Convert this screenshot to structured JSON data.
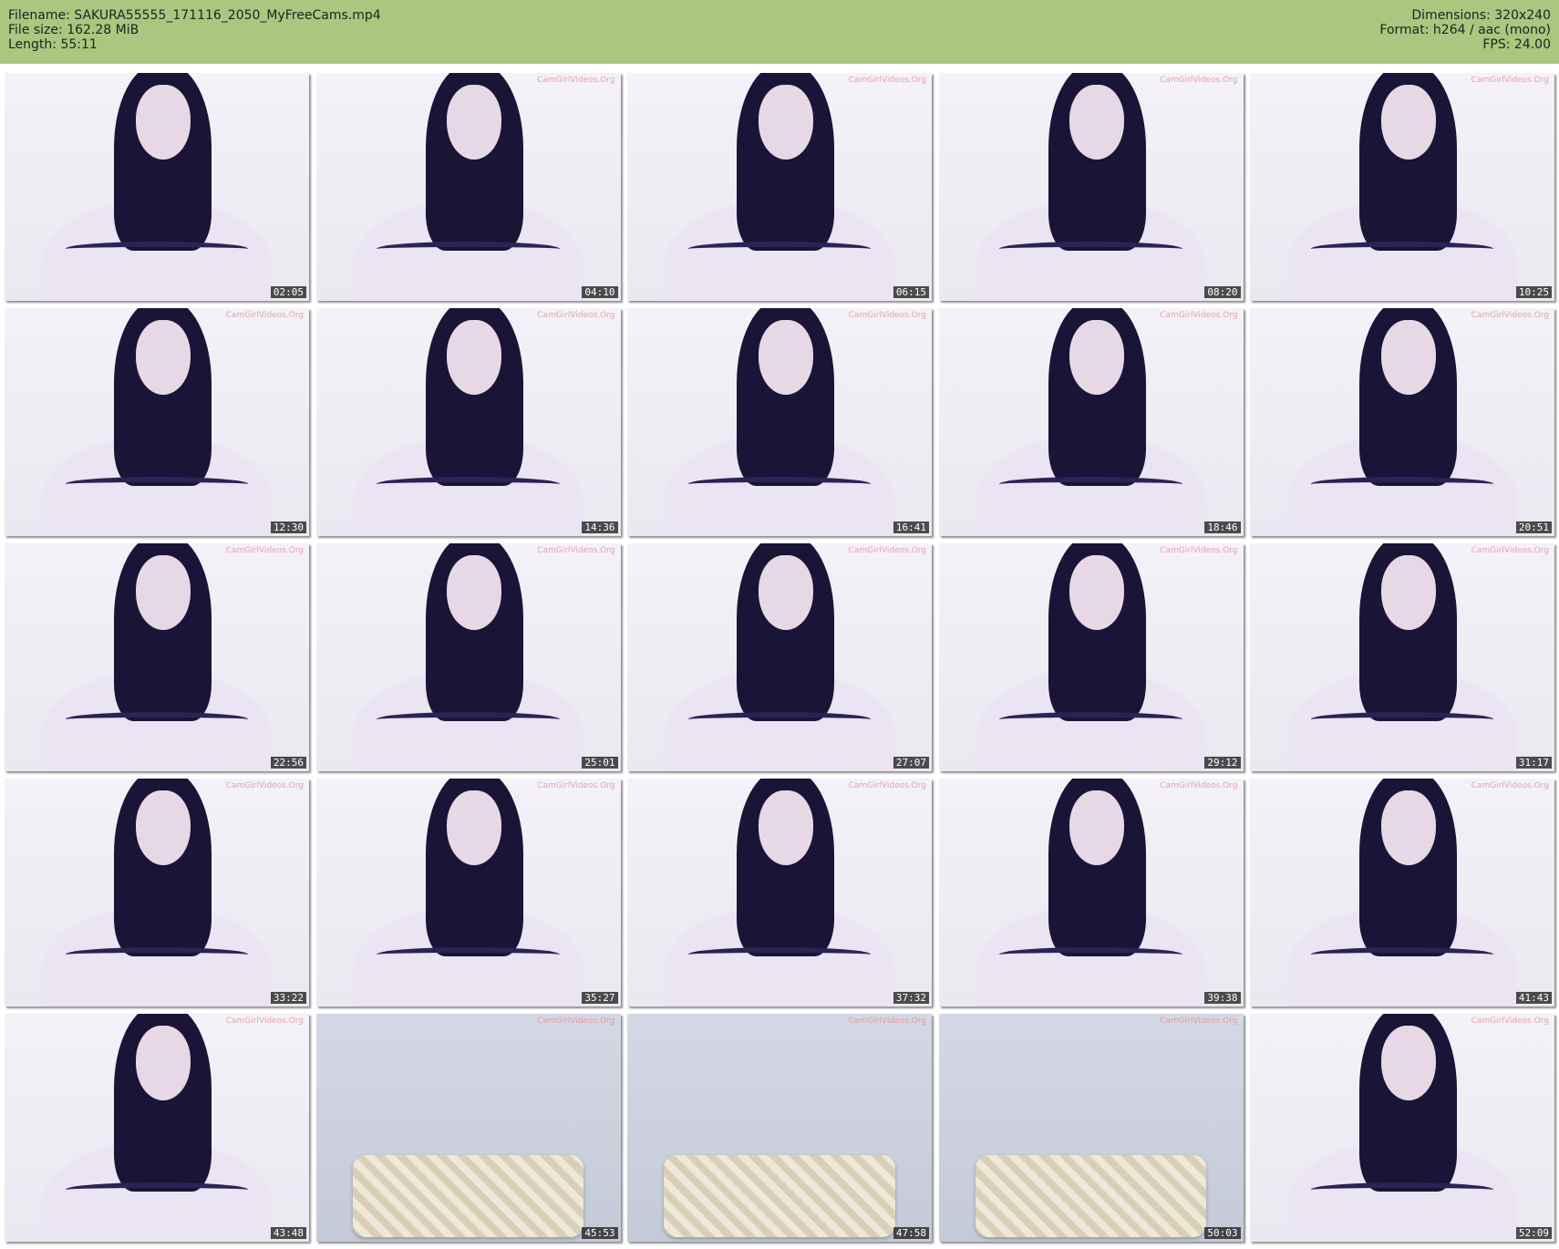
{
  "header": {
    "filename": "Filename: SAKURA55555_171116_2050_MyFreeCams.mp4",
    "file_size": "File size: 162.28 MiB",
    "length": "Length: 55:11",
    "dimensions": "Dimensions: 320x240",
    "format": "Format: h264 / aac (mono)",
    "fps": "FPS: 24.00"
  },
  "watermark_text": "CamGirlVideos.Org",
  "thumbnails": [
    {
      "time": "02:05",
      "scene": "person"
    },
    {
      "time": "04:10",
      "scene": "person"
    },
    {
      "time": "06:15",
      "scene": "person"
    },
    {
      "time": "08:20",
      "scene": "person"
    },
    {
      "time": "10:25",
      "scene": "person"
    },
    {
      "time": "12:30",
      "scene": "person"
    },
    {
      "time": "14:36",
      "scene": "person"
    },
    {
      "time": "16:41",
      "scene": "person"
    },
    {
      "time": "18:46",
      "scene": "person"
    },
    {
      "time": "20:51",
      "scene": "person"
    },
    {
      "time": "22:56",
      "scene": "person"
    },
    {
      "time": "25:01",
      "scene": "person"
    },
    {
      "time": "27:07",
      "scene": "person"
    },
    {
      "time": "29:12",
      "scene": "person"
    },
    {
      "time": "31:17",
      "scene": "person"
    },
    {
      "time": "33:22",
      "scene": "person"
    },
    {
      "time": "35:27",
      "scene": "person"
    },
    {
      "time": "37:32",
      "scene": "person"
    },
    {
      "time": "39:38",
      "scene": "person"
    },
    {
      "time": "41:43",
      "scene": "person"
    },
    {
      "time": "43:48",
      "scene": "person"
    },
    {
      "time": "45:53",
      "scene": "room"
    },
    {
      "time": "47:58",
      "scene": "room"
    },
    {
      "time": "50:03",
      "scene": "room"
    },
    {
      "time": "52:09",
      "scene": "person"
    }
  ],
  "colors": {
    "header_bg": "#a9c77f",
    "timestamp_bg": "#1e1e1e",
    "watermark": "#e48c99"
  }
}
